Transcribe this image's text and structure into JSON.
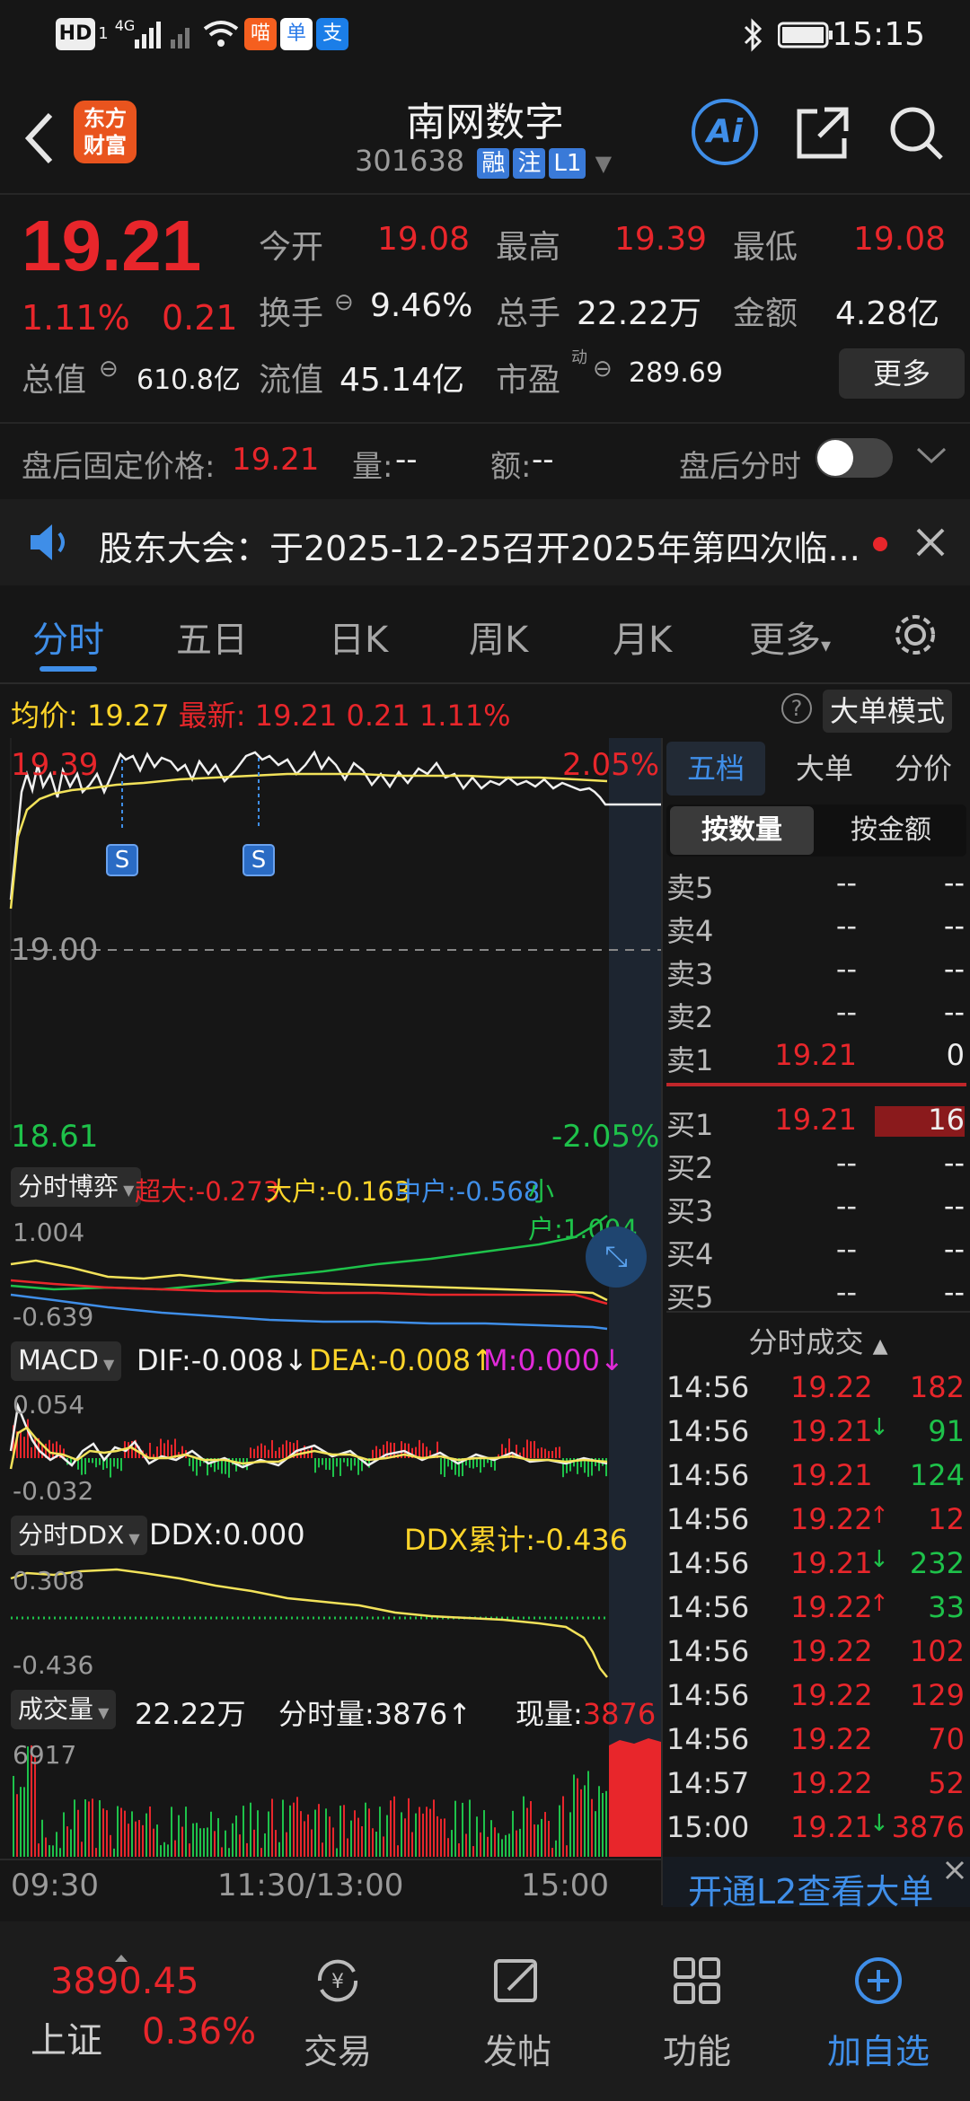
{
  "status": {
    "time": "15:15",
    "hd": "HD",
    "net": "4G",
    "badge_a": "1",
    "app_a": "喵",
    "app_b": "单",
    "app_c": "支"
  },
  "header": {
    "logo": "东方财富",
    "title": "南网数字",
    "code": "301638",
    "tags": [
      "融",
      "注",
      "L1"
    ],
    "ai": "Ai"
  },
  "quote": {
    "price": "19.21",
    "pct": "1.11%",
    "chg": "0.21",
    "open_label": "今开",
    "open": "19.08",
    "high_label": "最高",
    "high": "19.39",
    "low_label": "最低",
    "low": "19.08",
    "turnover_label": "换手",
    "turnover": "9.46%",
    "volume_label": "总手",
    "volume": "22.22万",
    "amount_label": "金额",
    "amount": "4.28亿",
    "mktcap_label": "总值",
    "mktcap": "610.8亿",
    "float_label": "流值",
    "float_val": "45.14亿",
    "pe_label": "市盈",
    "pe_sup": "动",
    "pe": "289.69",
    "more": "更多"
  },
  "afterhours": {
    "label": "盘后固定价格:",
    "price": "19.21",
    "vol_label": "量:",
    "vol": "--",
    "amt_label": "额:",
    "amt": "--",
    "toggle_label": "盘后分时"
  },
  "notice": {
    "text": "股东大会：于2025-12-25召开2025年第四次临..."
  },
  "tabs": [
    "分时",
    "五日",
    "日K",
    "周K",
    "月K",
    "更多"
  ],
  "avgbar": {
    "avg_label": "均价:",
    "avg": "19.27",
    "latest_label": "最新:",
    "latest": "19.21",
    "chg": "0.21",
    "pct": "1.11%",
    "mode": "大单模式",
    "help": "?"
  },
  "mainchart": {
    "high": "19.39",
    "high_pct": "2.05%",
    "mid": "19.00",
    "low": "18.61",
    "low_pct": "-2.05%",
    "marker": "S"
  },
  "game": {
    "label": "分时博弈",
    "super": "超大:-0.273",
    "big": "大户:-0.163",
    "mid": "中户:-0.568",
    "small": "小户:1.004",
    "top": "1.004",
    "bottom": "-0.639"
  },
  "macd": {
    "label": "MACD",
    "dif": "DIF:-0.008",
    "dif_arrow": "↓",
    "dea": "DEA:-0.008",
    "dea_arrow": "↑",
    "m": "M:0.000",
    "m_arrow": "↓",
    "top": "0.054",
    "bottom": "-0.032"
  },
  "ddx": {
    "label": "分时DDX",
    "ddx": "DDX:0.000",
    "cum": "DDX累计:-0.436",
    "top": "0.308",
    "bottom": "-0.436"
  },
  "volume": {
    "label": "成交量",
    "total": "22.22万",
    "period": "分时量:3876",
    "period_arrow": "↑",
    "now_label": "现量:",
    "now": "3876",
    "top": "6917"
  },
  "timeaxis": [
    "09:30",
    "11:30/13:00",
    "15:00"
  ],
  "orderbook": {
    "tabs": [
      "五档",
      "大单",
      "分价"
    ],
    "subtabs": [
      "按数量",
      "按金额"
    ],
    "sell": [
      {
        "label": "卖5",
        "price": "--",
        "qty": "--"
      },
      {
        "label": "卖4",
        "price": "--",
        "qty": "--"
      },
      {
        "label": "卖3",
        "price": "--",
        "qty": "--"
      },
      {
        "label": "卖2",
        "price": "--",
        "qty": "--"
      },
      {
        "label": "卖1",
        "price": "19.21",
        "qty": "0"
      }
    ],
    "buy": [
      {
        "label": "买1",
        "price": "19.21",
        "qty": "16"
      },
      {
        "label": "买2",
        "price": "--",
        "qty": "--"
      },
      {
        "label": "买3",
        "price": "--",
        "qty": "--"
      },
      {
        "label": "买4",
        "price": "--",
        "qty": "--"
      },
      {
        "label": "买5",
        "price": "--",
        "qty": "--"
      }
    ]
  },
  "ticks": {
    "title": "分时成交",
    "rows": [
      {
        "t": "14:56",
        "p": "19.22",
        "a": "",
        "q": "182",
        "c": "red"
      },
      {
        "t": "14:56",
        "p": "19.21",
        "a": "↓",
        "q": "91",
        "c": "green"
      },
      {
        "t": "14:56",
        "p": "19.21",
        "a": "",
        "q": "124",
        "c": "green"
      },
      {
        "t": "14:56",
        "p": "19.22",
        "a": "↑",
        "q": "12",
        "c": "red"
      },
      {
        "t": "14:56",
        "p": "19.21",
        "a": "↓",
        "q": "232",
        "c": "green"
      },
      {
        "t": "14:56",
        "p": "19.22",
        "a": "↑",
        "q": "33",
        "c": "green"
      },
      {
        "t": "14:56",
        "p": "19.22",
        "a": "",
        "q": "102",
        "c": "red"
      },
      {
        "t": "14:56",
        "p": "19.22",
        "a": "",
        "q": "129",
        "c": "red"
      },
      {
        "t": "14:56",
        "p": "19.22",
        "a": "",
        "q": "70",
        "c": "red"
      },
      {
        "t": "14:57",
        "p": "19.22",
        "a": "",
        "q": "52",
        "c": "red"
      },
      {
        "t": "15:00",
        "p": "19.21",
        "a": "↓",
        "q": "3876",
        "c": "red"
      }
    ],
    "l2": "开通L2查看大单"
  },
  "bottom": {
    "index_value": "3890.45",
    "index_name": "上证",
    "index_pct": "0.36%",
    "items": [
      "交易",
      "发帖",
      "功能",
      "加自选"
    ]
  }
}
